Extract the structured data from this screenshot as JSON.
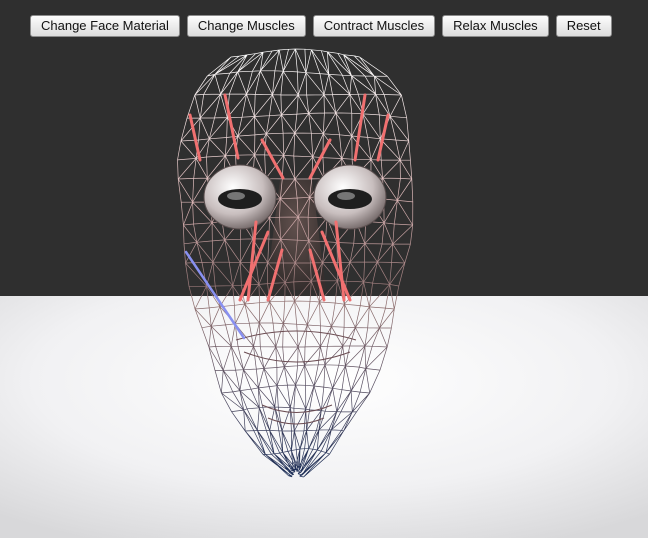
{
  "toolbar": {
    "buttons": [
      {
        "id": "change-face-material",
        "label": "Change Face Material"
      },
      {
        "id": "change-muscles",
        "label": "Change Muscles"
      },
      {
        "id": "contract-muscles",
        "label": "Contract Muscles"
      },
      {
        "id": "relax-muscles",
        "label": "Relax Muscles"
      },
      {
        "id": "reset",
        "label": "Reset"
      }
    ]
  },
  "scene": {
    "background_color": "#2f2f2f",
    "floor_color": "#e9e9eb",
    "wireframe_top_color": "#ffffff",
    "wireframe_bottom_color": "#1a2c55",
    "muscle_color": "#f07070",
    "relaxed_muscle_color": "#8890f0",
    "eye_color": "#d8d0d0"
  }
}
